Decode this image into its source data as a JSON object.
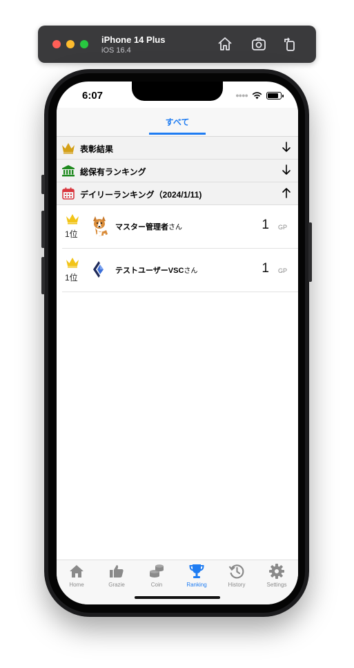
{
  "simulator": {
    "device_name": "iPhone 14 Plus",
    "os_version": "iOS 16.4",
    "toolbar_icons": [
      "home-icon",
      "screenshot-icon",
      "rotate-icon"
    ]
  },
  "status_bar": {
    "time": "6:07",
    "icons": [
      "signal-dots-icon",
      "wifi-icon",
      "battery-icon"
    ]
  },
  "top_tabs": {
    "items": [
      {
        "label": "すべて",
        "active": true
      }
    ],
    "accent_color": "#1e7cf2"
  },
  "sections": [
    {
      "label": "表彰結果",
      "icon": "crown-icon",
      "icon_color": "#d4a017",
      "expanded": false,
      "arrow": "arrow-down-icon"
    },
    {
      "label": "総保有ランキング",
      "icon": "bank-icon",
      "icon_color": "#1f8a1f",
      "expanded": false,
      "arrow": "arrow-down-icon"
    },
    {
      "label": "デイリーランキング（2024/1/11)",
      "icon": "calendar-icon",
      "icon_color": "#d9363e",
      "expanded": true,
      "arrow": "arrow-up-icon"
    }
  ],
  "ranking": [
    {
      "rank": "1位",
      "avatar": "corgi-avatar",
      "name": "マスター管理者",
      "suffix": "さん",
      "score": "1",
      "unit": "GP"
    },
    {
      "rank": "1位",
      "avatar": "app-logo-avatar",
      "name": "テストユーザーVSC",
      "suffix": "さん",
      "score": "1",
      "unit": "GP"
    }
  ],
  "tab_bar": {
    "items": [
      {
        "label": "Home",
        "icon": "home-icon",
        "active": false
      },
      {
        "label": "Grazie",
        "icon": "thumbs-up-icon",
        "active": false
      },
      {
        "label": "Coin",
        "icon": "coins-icon",
        "active": false
      },
      {
        "label": "Ranking",
        "icon": "trophy-icon",
        "active": true
      },
      {
        "label": "History",
        "icon": "history-icon",
        "active": false
      },
      {
        "label": "Settings",
        "icon": "gear-icon",
        "active": false
      }
    ],
    "active_color": "#1e7cf2",
    "inactive_color": "#8a8a8a"
  }
}
